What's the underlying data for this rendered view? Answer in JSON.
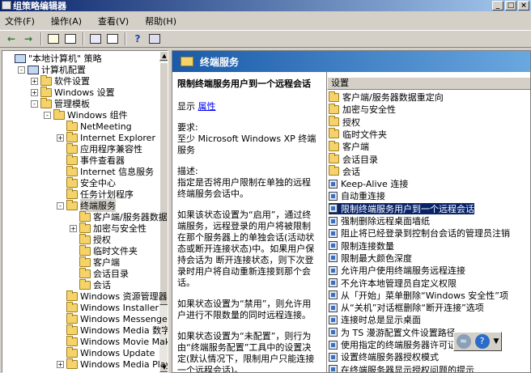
{
  "window": {
    "title": "组策略编辑器"
  },
  "menu": [
    "文件(F)",
    "操作(A)",
    "查看(V)",
    "帮助(H)"
  ],
  "tree": [
    {
      "label": "\"本地计算机\" 策略",
      "indent": 0,
      "icon": "computer",
      "exp": ""
    },
    {
      "label": "计算机配置",
      "indent": 1,
      "icon": "computer",
      "exp": "-"
    },
    {
      "label": "软件设置",
      "indent": 2,
      "icon": "folder",
      "exp": "+"
    },
    {
      "label": "Windows 设置",
      "indent": 2,
      "icon": "folder",
      "exp": "+"
    },
    {
      "label": "管理模板",
      "indent": 2,
      "icon": "folder",
      "exp": "-"
    },
    {
      "label": "Windows 组件",
      "indent": 3,
      "icon": "folder",
      "exp": "-"
    },
    {
      "label": "NetMeeting",
      "indent": 4,
      "icon": "folder",
      "exp": ""
    },
    {
      "label": "Internet Explorer",
      "indent": 4,
      "icon": "folder",
      "exp": "+"
    },
    {
      "label": "应用程序兼容性",
      "indent": 4,
      "icon": "folder",
      "exp": ""
    },
    {
      "label": "事件查看器",
      "indent": 4,
      "icon": "folder",
      "exp": ""
    },
    {
      "label": "Internet 信息服务",
      "indent": 4,
      "icon": "folder",
      "exp": ""
    },
    {
      "label": "安全中心",
      "indent": 4,
      "icon": "folder",
      "exp": ""
    },
    {
      "label": "任务计划程序",
      "indent": 4,
      "icon": "folder",
      "exp": ""
    },
    {
      "label": "终端服务",
      "indent": 4,
      "icon": "folder",
      "exp": "-",
      "selected": true
    },
    {
      "label": "客户端/服务器数据",
      "indent": 5,
      "icon": "folder",
      "exp": ""
    },
    {
      "label": "加密与安全性",
      "indent": 5,
      "icon": "folder",
      "exp": "+"
    },
    {
      "label": "授权",
      "indent": 5,
      "icon": "folder",
      "exp": ""
    },
    {
      "label": "临时文件夹",
      "indent": 5,
      "icon": "folder",
      "exp": ""
    },
    {
      "label": "客户端",
      "indent": 5,
      "icon": "folder",
      "exp": ""
    },
    {
      "label": "会话目录",
      "indent": 5,
      "icon": "folder",
      "exp": ""
    },
    {
      "label": "会话",
      "indent": 5,
      "icon": "folder",
      "exp": ""
    },
    {
      "label": "Windows 资源管理器",
      "indent": 4,
      "icon": "folder",
      "exp": ""
    },
    {
      "label": "Windows Installer",
      "indent": 4,
      "icon": "folder",
      "exp": ""
    },
    {
      "label": "Windows Messenger",
      "indent": 4,
      "icon": "folder",
      "exp": ""
    },
    {
      "label": "Windows Media 数字权",
      "indent": 4,
      "icon": "folder",
      "exp": ""
    },
    {
      "label": "Windows Movie Maker",
      "indent": 4,
      "icon": "folder",
      "exp": ""
    },
    {
      "label": "Windows Update",
      "indent": 4,
      "icon": "folder",
      "exp": ""
    },
    {
      "label": "Windows Media Player",
      "indent": 4,
      "icon": "folder",
      "exp": "+"
    }
  ],
  "header": {
    "title": "终端服务"
  },
  "desc": {
    "title": "限制终端服务用户到一个远程会话",
    "show_label": "显示",
    "properties_link": "属性",
    "req_label": "要求:",
    "req_text": "至少 Microsoft Windows XP 终端服务",
    "desc_label": "描述:",
    "p1": "指定是否将用户限制在单独的远程终端服务会话中。",
    "p2": "如果该状态设置为“启用”，通过终端服务，远程登录的用户将被限制在那个服务器上的单独会话(活动状态或断开连接状态)中。如果用户保持会话为 断开连接状态，则下次登录时用户将自动重新连接到那个会话。",
    "p3": "如果状态设置为“禁用”，则允许用户进行不限数量的同时远程连接。",
    "p4": "如果状态设置为“未配置”，则行为由“终端服务配置”工具中的设置决定(默认情况下，限制用户只能连接一个远程会话)。"
  },
  "list": {
    "header": "设置",
    "items": [
      {
        "label": "客户端/服务器数据重定向",
        "icon": "folder"
      },
      {
        "label": "加密与安全性",
        "icon": "folder"
      },
      {
        "label": "授权",
        "icon": "folder"
      },
      {
        "label": "临时文件夹",
        "icon": "folder"
      },
      {
        "label": "客户端",
        "icon": "folder"
      },
      {
        "label": "会话目录",
        "icon": "folder"
      },
      {
        "label": "会话",
        "icon": "folder"
      },
      {
        "label": "Keep-Alive 连接",
        "icon": "setting"
      },
      {
        "label": "自动重连接",
        "icon": "setting"
      },
      {
        "label": "限制终端服务用户到一个远程会话",
        "icon": "setting",
        "selected": true
      },
      {
        "label": "强制删除远程桌面墙纸",
        "icon": "setting"
      },
      {
        "label": "阻止将已经登录到控制台会话的管理员注销",
        "icon": "setting"
      },
      {
        "label": "限制连接数量",
        "icon": "setting"
      },
      {
        "label": "限制最大颜色深度",
        "icon": "setting"
      },
      {
        "label": "允许用户使用终端服务远程连接",
        "icon": "setting"
      },
      {
        "label": "不允许本地管理员自定义权限",
        "icon": "setting"
      },
      {
        "label": "从「开始」菜单删除“Windows 安全性”项",
        "icon": "setting"
      },
      {
        "label": "从“关机”对话框删除“断开连接”选项",
        "icon": "setting"
      },
      {
        "label": "连接时总是显示桌面",
        "icon": "setting"
      },
      {
        "label": "为 TS 漫游配置文件设置路径",
        "icon": "setting"
      },
      {
        "label": "使用指定的终端服务器许可证服务器",
        "icon": "setting"
      },
      {
        "label": "设置终端服务器授权模式",
        "icon": "setting"
      },
      {
        "label": "在终端服务器显示授权问题的提示",
        "icon": "setting"
      }
    ]
  }
}
